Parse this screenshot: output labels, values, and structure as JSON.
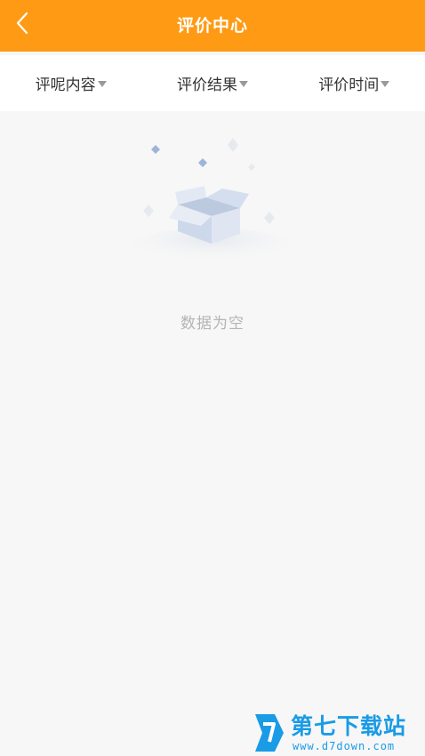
{
  "header": {
    "back_icon": "chevron-left-icon",
    "title": "评价中心",
    "bg_color": "#ff9a14"
  },
  "filters": [
    {
      "label": "评呢内容",
      "icon": "triangle-down-icon"
    },
    {
      "label": "评价结果",
      "icon": "triangle-down-icon"
    },
    {
      "label": "评价时间",
      "icon": "triangle-down-icon"
    }
  ],
  "empty_state": {
    "icon": "empty-box-icon",
    "text": "数据为空"
  },
  "watermark": {
    "name": "第七下载站",
    "url": "www.d7down.com",
    "color": "#1a9be6"
  }
}
